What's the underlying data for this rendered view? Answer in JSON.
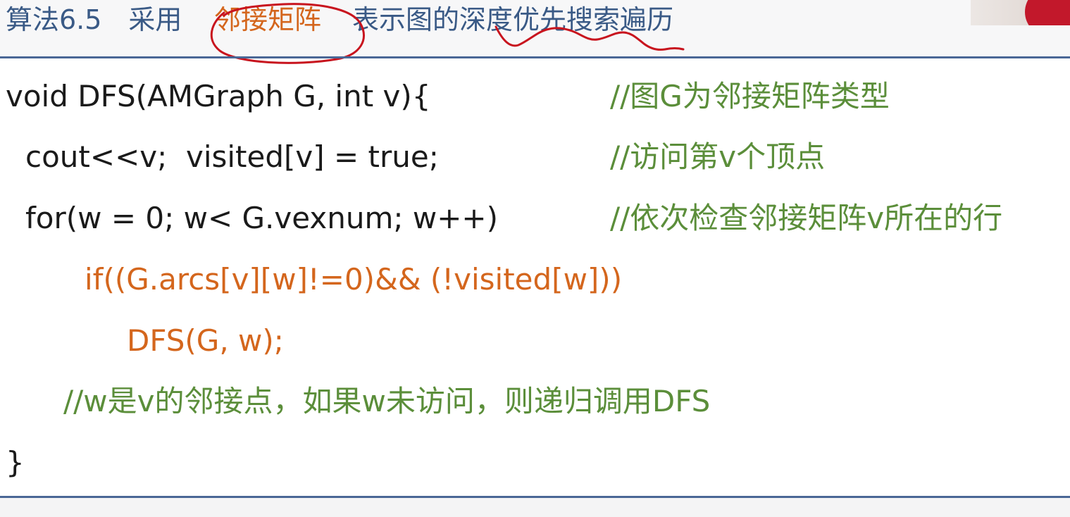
{
  "title": {
    "prefix": "算法6.5　采用",
    "highlight": "邻接矩阵",
    "suffix": "表示图的深度优先搜索遍历"
  },
  "code": {
    "line1": {
      "code": "void DFS(AMGraph G, int v){",
      "comment": "//图G为邻接矩阵类型"
    },
    "line2": {
      "code": "cout<<v;  visited[v] = true;",
      "comment": "//访问第v个顶点"
    },
    "line3": {
      "code": "for(w = 0; w< G.vexnum; w++)",
      "comment": "//依次检查邻接矩阵v所在的行"
    },
    "line4": {
      "code": "if((G.arcs[v][w]!=0)&& (!visited[w]))"
    },
    "line5": {
      "code": "DFS(G, w);"
    },
    "line6": {
      "comment": "//w是v的邻接点，如果w未访问，则递归调用DFS"
    },
    "line7": {
      "code": "}"
    }
  },
  "colors": {
    "title": "#3a5a86",
    "highlight": "#d4661d",
    "code": "#1a1a1a",
    "code_emphasis": "#d4661d",
    "comment": "#5b8e3a",
    "rule": "#4a6796",
    "annotation_ink": "#c8141e"
  }
}
